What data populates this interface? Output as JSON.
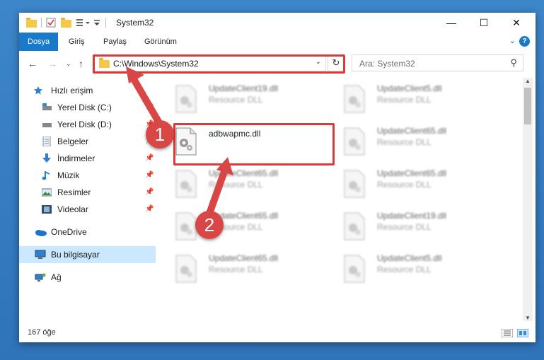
{
  "window": {
    "title": "System32",
    "buttons": {
      "minimize": "—",
      "maximize": "☐",
      "close": "✕"
    }
  },
  "ribbon": {
    "tabs": [
      "Dosya",
      "Giriş",
      "Paylaş",
      "Görünüm"
    ],
    "help": "?"
  },
  "navigation": {
    "address": "C:\\Windows\\System32",
    "search_placeholder": "Ara: System32"
  },
  "sidebar": {
    "items": [
      {
        "label": "Hızlı erişim",
        "icon": "star-icon",
        "pinned": false
      },
      {
        "label": "Yerel Disk (C:)",
        "icon": "drive-c-icon",
        "pinned": true
      },
      {
        "label": "Yerel Disk (D:)",
        "icon": "drive-d-icon",
        "pinned": true
      },
      {
        "label": "Belgeler",
        "icon": "documents-icon",
        "pinned": true
      },
      {
        "label": "İndirmeler",
        "icon": "downloads-icon",
        "pinned": true
      },
      {
        "label": "Müzik",
        "icon": "music-icon",
        "pinned": true
      },
      {
        "label": "Resimler",
        "icon": "pictures-icon",
        "pinned": true
      },
      {
        "label": "Videolar",
        "icon": "videos-icon",
        "pinned": true
      },
      {
        "label": "OneDrive",
        "icon": "onedrive-icon",
        "pinned": false
      },
      {
        "label": "Bu bilgisayar",
        "icon": "this-pc-icon",
        "pinned": false
      },
      {
        "label": "Ağ",
        "icon": "network-icon",
        "pinned": false
      }
    ]
  },
  "files": [
    {
      "name": "UpdateClient19.dll",
      "type": "Resource DLL"
    },
    {
      "name": "UpdateClient5.dll",
      "type": "Resource DLL"
    },
    {
      "name": "adbwapmc.dll",
      "type": ""
    },
    {
      "name": "UpdateClient65.dll",
      "type": "Resource DLL"
    },
    {
      "name": "UpdateClient65.dll",
      "type": "Resource DLL"
    },
    {
      "name": "UpdateClient65.dll",
      "type": "Resource DLL"
    },
    {
      "name": "UpdateClient65.dll",
      "type": "Resource DLL"
    },
    {
      "name": "UpdateClient19.dll",
      "type": "Resource DLL"
    },
    {
      "name": "UpdateClient65.dll",
      "type": "Resource DLL"
    },
    {
      "name": "UpdateClient5.dll",
      "type": "Resource DLL"
    }
  ],
  "status": {
    "item_count": "167 öğe"
  },
  "annotations": {
    "badge1": "1",
    "badge2": "2"
  },
  "colors": {
    "accent": "#1979ca",
    "highlight": "#d93a3a",
    "selected": "#cce8ff"
  }
}
